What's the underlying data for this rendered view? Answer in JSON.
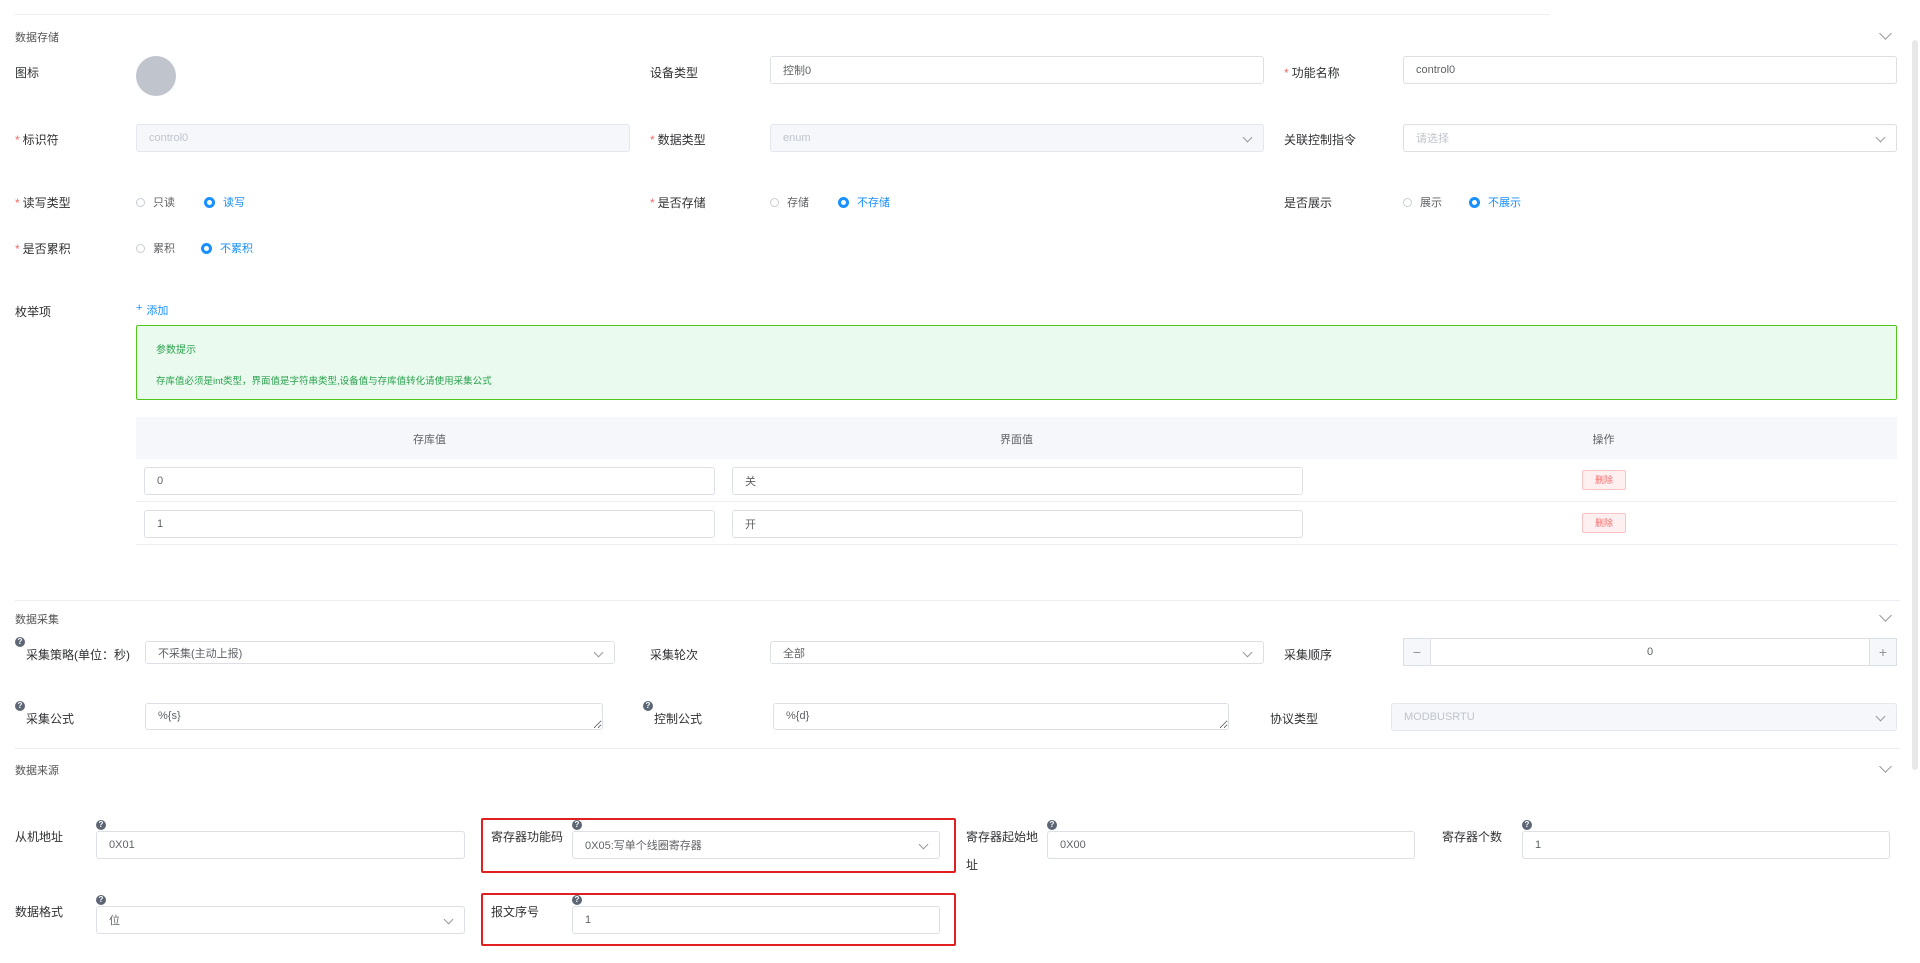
{
  "storage": {
    "title": "数据存储",
    "icon_label": "图标",
    "device_type_label": "设备类型",
    "device_type_value": "控制0",
    "func_name_label": "功能名称",
    "func_name_value": "control0",
    "identifier_label": "标识符",
    "identifier_value": "control0",
    "data_type_label": "数据类型",
    "data_type_value": "enum",
    "control_cmd_label": "关联控制指令",
    "control_cmd_placeholder": "请选择",
    "rw_label": "读写类型",
    "rw_opts": [
      "只读",
      "读写"
    ],
    "store_label": "是否存储",
    "store_opts": [
      "存储",
      "不存储"
    ],
    "show_label": "是否展示",
    "show_opts": [
      "展示",
      "不展示"
    ],
    "accum_label": "是否累积",
    "accum_opts": [
      "累积",
      "不累积"
    ],
    "enum_label": "枚举项",
    "add_label": "添加",
    "tip_title": "参数提示",
    "tip_text": "存库值必须是int类型，界面值是字符串类型,设备值与存库值转化请使用采集公式",
    "table": {
      "headers": [
        "存库值",
        "界面值",
        "操作"
      ],
      "rows": [
        {
          "store": "0",
          "display": "关",
          "action": "删除"
        },
        {
          "store": "1",
          "display": "开",
          "action": "删除"
        }
      ]
    }
  },
  "collect": {
    "title": "数据采集",
    "strategy_label": "采集策略(单位：秒)",
    "strategy_value": "不采集(主动上报)",
    "round_label": "采集轮次",
    "round_value": "全部",
    "order_label": "采集顺序",
    "order_value": "0",
    "formula_label": "采集公式",
    "formula_value": "%{s}",
    "ctrl_formula_label": "控制公式",
    "ctrl_formula_value": "%{d}",
    "protocol_label": "协议类型",
    "protocol_value": "MODBUSRTU"
  },
  "source": {
    "title": "数据来源",
    "slave_label": "从机地址",
    "slave_value": "0X01",
    "func_code_label": "寄存器功能码",
    "func_code_value": "0X05:写单个线圈寄存器",
    "start_addr_label_1": "寄存器起始地",
    "start_addr_label_2": "址",
    "start_addr_value": "0X00",
    "count_label": "寄存器个数",
    "count_value": "1",
    "format_label": "数据格式",
    "format_value": "位",
    "msg_label": "报文序号",
    "msg_value": "1"
  },
  "colors": {
    "accent": "#1890ff",
    "danger": "#f56c6c",
    "highlight": "#e02020",
    "tip_border": "#52c41a"
  }
}
